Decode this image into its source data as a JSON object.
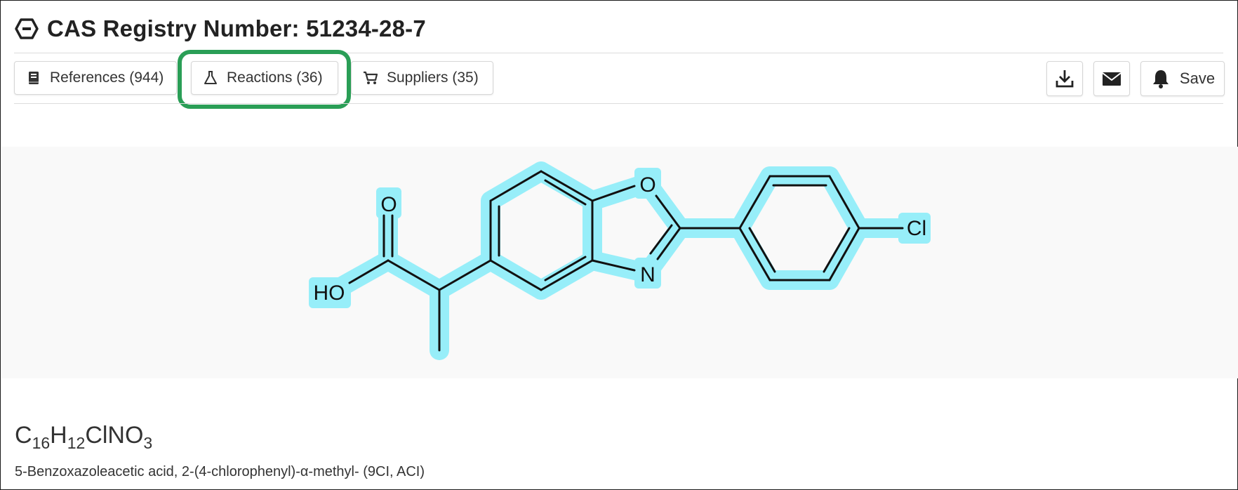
{
  "header": {
    "icon": "hexagon-substance-icon",
    "title": "CAS Registry Number: 51234-28-7"
  },
  "tabs": [
    {
      "label": "References (944)",
      "icon": "book-icon"
    },
    {
      "label": "Reactions (36)",
      "icon": "flask-icon",
      "highlighted": true
    },
    {
      "label": "Suppliers (35)",
      "icon": "cart-icon"
    }
  ],
  "actions": {
    "download_icon": "download-icon",
    "email_icon": "envelope-icon",
    "save_label": "Save",
    "save_icon": "bell-icon"
  },
  "structure": {
    "highlight_color": "#97eef9",
    "atoms": {
      "O_carbonyl": "O",
      "OH": "HO",
      "O_ring": "O",
      "N_ring": "N",
      "Cl": "Cl"
    }
  },
  "formula": {
    "parts": [
      {
        "el": "C",
        "n": "16"
      },
      {
        "el": "H",
        "n": "12"
      },
      {
        "el": "ClNO",
        "n": "3"
      }
    ]
  },
  "name": "5-Benzoxazoleacetic acid, 2-(4-chlorophenyl)-α-methyl- (9CI, ACI)",
  "colors": {
    "highlight_border": "#2a9e56",
    "structure_bg": "#f9f9f9"
  }
}
